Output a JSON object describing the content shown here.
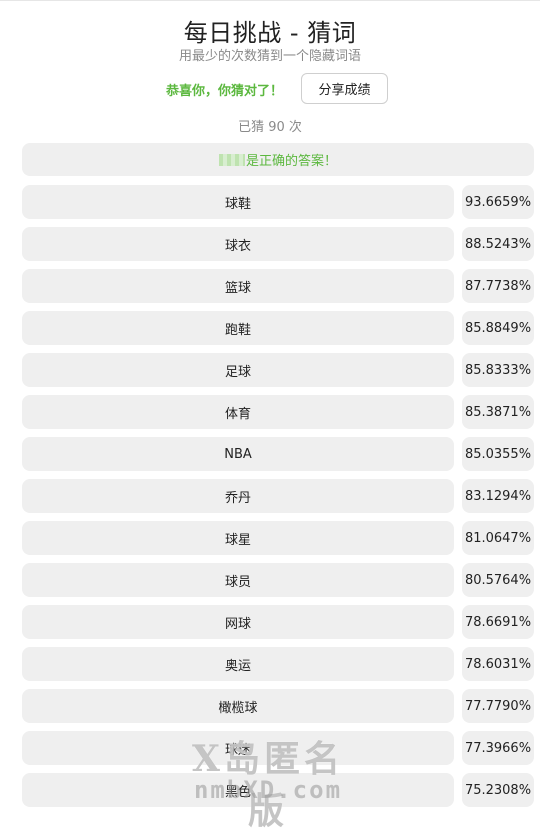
{
  "header": {
    "title": "每日挑战 - 猜词",
    "subtitle": "用最少的次数猜到一个隐藏词语"
  },
  "result": {
    "congrats": "恭喜你，你猜对了！",
    "share_label": "分享成绩",
    "guess_count": "已猜 90 次",
    "answer_suffix": "是正确的答案！"
  },
  "guesses": [
    {
      "word": "球鞋",
      "score": "93.6659%"
    },
    {
      "word": "球衣",
      "score": "88.5243%"
    },
    {
      "word": "篮球",
      "score": "87.7738%"
    },
    {
      "word": "跑鞋",
      "score": "85.8849%"
    },
    {
      "word": "足球",
      "score": "85.8333%"
    },
    {
      "word": "体育",
      "score": "85.3871%"
    },
    {
      "word": "NBA",
      "score": "85.0355%"
    },
    {
      "word": "乔丹",
      "score": "83.1294%"
    },
    {
      "word": "球星",
      "score": "81.0647%"
    },
    {
      "word": "球员",
      "score": "80.5764%"
    },
    {
      "word": "网球",
      "score": "78.6691%"
    },
    {
      "word": "奥运",
      "score": "78.6031%"
    },
    {
      "word": "橄榄球",
      "score": "77.7790%"
    },
    {
      "word": "球迷",
      "score": "77.3966%"
    },
    {
      "word": "黑色",
      "score": "75.2308%"
    }
  ],
  "watermark": {
    "line1": "X岛匿名版",
    "line2": "nmbXD.com"
  },
  "colors": {
    "accent_green": "#5cb83f",
    "row_bg": "#efefef"
  }
}
